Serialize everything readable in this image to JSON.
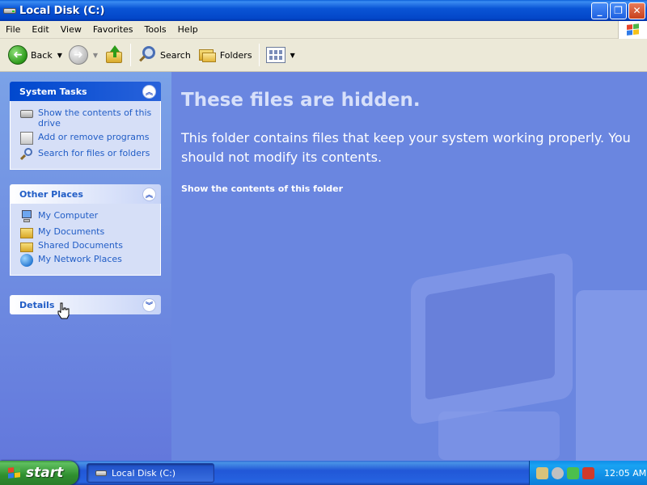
{
  "window": {
    "title": "Local Disk (C:)",
    "controls": {
      "minimize": "_",
      "maximize": "❐",
      "close": "✕"
    }
  },
  "menu": [
    "File",
    "Edit",
    "View",
    "Favorites",
    "Tools",
    "Help"
  ],
  "toolbar": {
    "back_label": "Back",
    "forward_glyph": "➜",
    "back_glyph": "➜",
    "search_label": "Search",
    "folders_label": "Folders"
  },
  "system_tasks": {
    "title": "System Tasks",
    "items": [
      "Show the contents of this drive",
      "Add or remove programs",
      "Search for files or folders"
    ]
  },
  "other_places": {
    "title": "Other Places",
    "items": [
      "My Computer",
      "My Documents",
      "Shared Documents",
      "My Network Places"
    ]
  },
  "details": {
    "title": "Details"
  },
  "content": {
    "heading": "These files are hidden.",
    "message": "This folder contains files that keep your system working properly. You should not modify its contents.",
    "link": "Show the contents of this folder"
  },
  "taskbar": {
    "start_label": "start",
    "window_button": "Local Disk (C:)",
    "clock": "12:05 AM"
  },
  "colors": {
    "titlebar": "#0a55d6",
    "link_blue": "#215dc6",
    "content_bg": "#6a86e0",
    "taskbar": "#2157d7",
    "start_green": "#2f8f2f"
  }
}
